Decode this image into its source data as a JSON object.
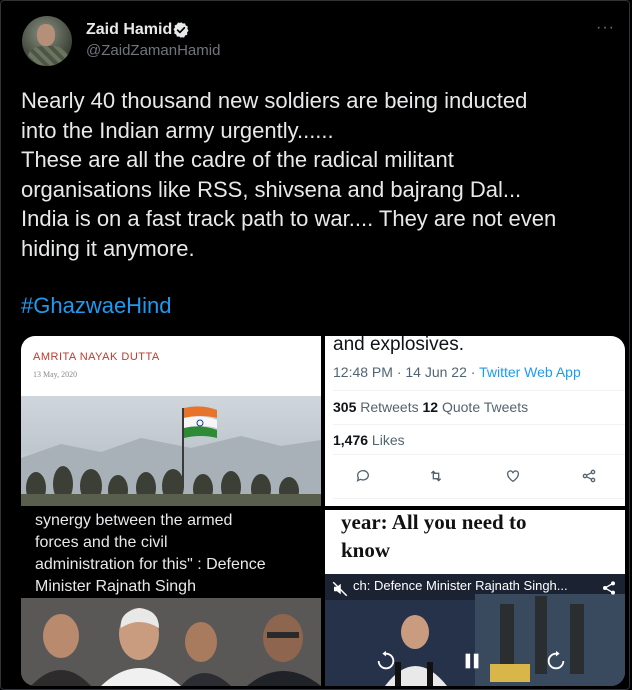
{
  "user": {
    "name": "Zaid Hamid",
    "handle": "@ZaidZamanHamid"
  },
  "tweet": {
    "lines": [
      "Nearly 40 thousand new soldiers are being inducted",
      "into the Indian army urgently......",
      "These are all the cadre of the radical militant",
      "organisations like RSS, shivsena and bajrang Dal...",
      "India is on a fast track path to war.... They are not even",
      "hiding it anymore."
    ],
    "hashtag": "#GhazwaeHind"
  },
  "media": {
    "article": {
      "author": "AMRITA NAYAK DUTTA",
      "date": "13 May, 2020"
    },
    "screenshot": {
      "top_text": "and explosives.",
      "time": "12:48 PM · 14 Jun 22 · ",
      "app": "Twitter Web App",
      "retweets_count": "305",
      "retweets_label": " Retweets  ",
      "quotes_count": "12",
      "quotes_label": " Quote Tweets",
      "likes_count": "1,476",
      "likes_label": " Likes"
    },
    "caption": {
      "lines": [
        "synergy between the armed",
        "forces and the civil",
        "administration for this\" : Defence",
        "Minister Rajnath Singh"
      ]
    },
    "news": {
      "headline_lines": [
        "year: All you need to",
        "know"
      ],
      "video_title": "ch: Defence Minister Rajnath Singh..."
    }
  },
  "colors": {
    "accent": "#1d9bf0",
    "background": "#000000",
    "text": "#e7e9ea",
    "secondary": "#71767b"
  }
}
